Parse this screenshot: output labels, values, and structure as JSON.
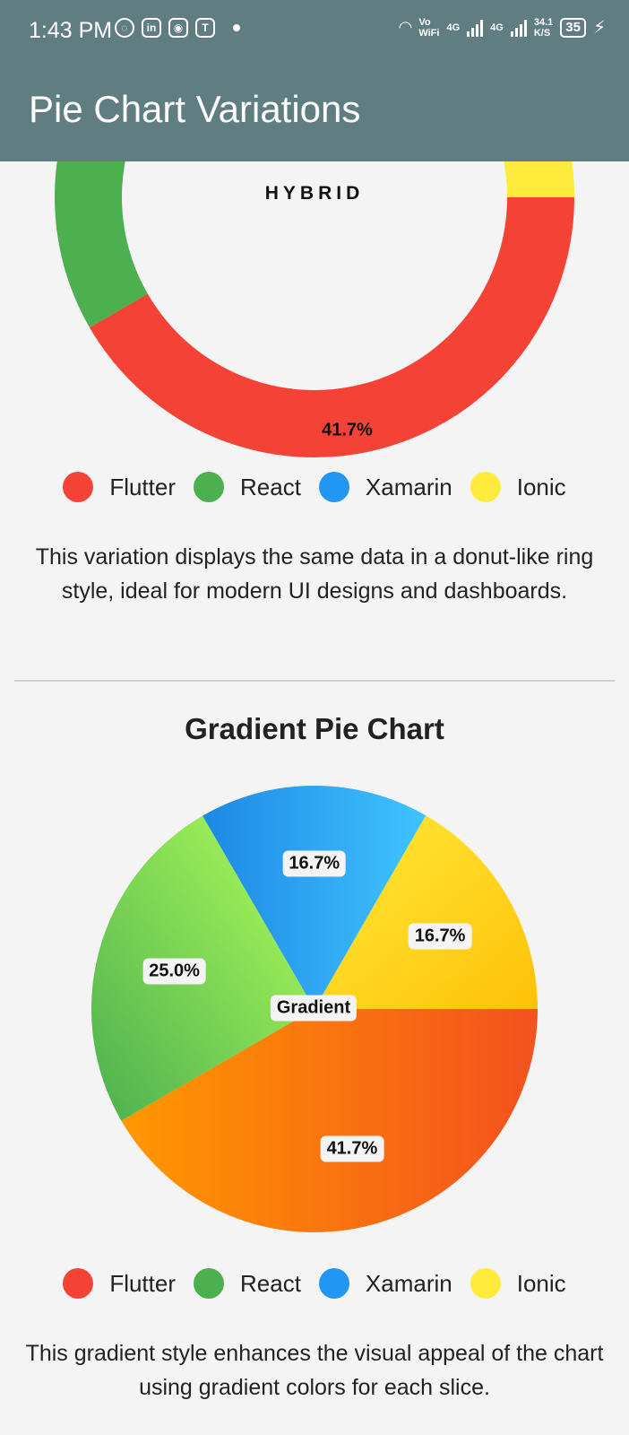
{
  "status_bar": {
    "time": "1:43 PM",
    "vo_wifi_top": "Vo",
    "vo_wifi_bottom": "WiFi",
    "net1": "4G",
    "net2": "4G",
    "speed_top": "34.1",
    "speed_bottom": "K/S",
    "battery": "35"
  },
  "app_bar": {
    "title": "Pie Chart Variations"
  },
  "donut": {
    "center_label": "HYBRID",
    "labels": {
      "flutter": "41.7%"
    },
    "description": "This variation displays the same data in a donut-like ring style, ideal for modern UI designs and dashboards."
  },
  "legend": [
    {
      "label": "Flutter",
      "color": "#f44336"
    },
    {
      "label": "React",
      "color": "#4caf50"
    },
    {
      "label": "Xamarin",
      "color": "#2196f3"
    },
    {
      "label": "Ionic",
      "color": "#ffeb3b"
    }
  ],
  "gradient_section": {
    "title": "Gradient Pie Chart",
    "center_label": "Gradient",
    "description": "This gradient style enhances the visual appeal of the chart using gradient colors for each slice."
  },
  "chart_data": [
    {
      "type": "pie",
      "variant": "donut",
      "categories": [
        "Flutter",
        "React",
        "Xamarin",
        "Ionic"
      ],
      "values": [
        41.7,
        25.0,
        16.7,
        16.7
      ],
      "colors": [
        "#f44336",
        "#4caf50",
        "#2196f3",
        "#ffeb3b"
      ]
    },
    {
      "type": "pie",
      "variant": "gradient",
      "categories": [
        "Flutter",
        "React",
        "Xamarin",
        "Ionic"
      ],
      "values": [
        41.7,
        25.0,
        16.7,
        16.7
      ],
      "value_labels": [
        "41.7%",
        "25.0%",
        "16.7%",
        "16.7%"
      ]
    }
  ]
}
